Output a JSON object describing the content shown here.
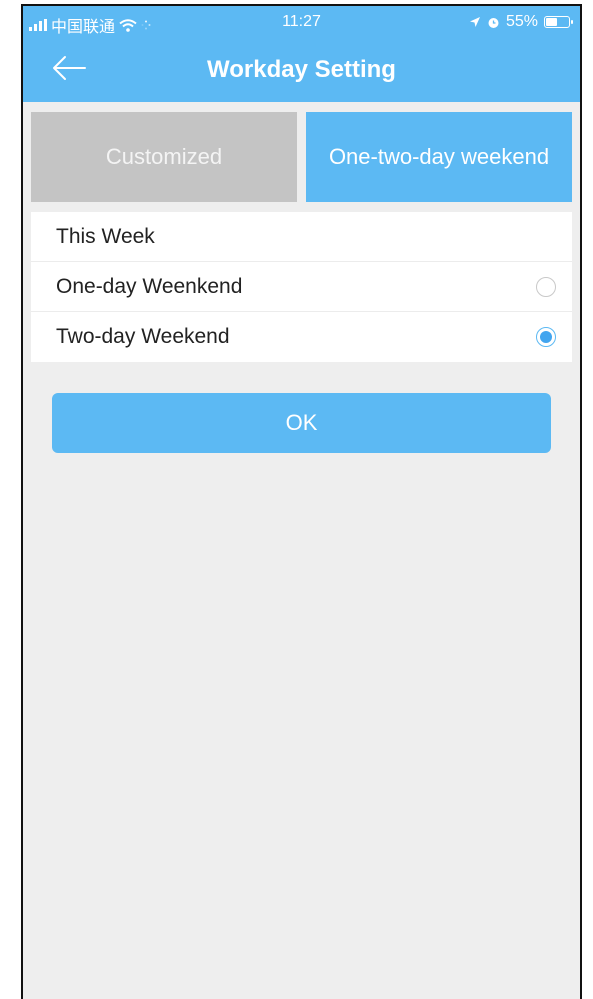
{
  "status_bar": {
    "carrier": "中国联通",
    "time": "11:27",
    "battery": "55%",
    "battery_level": 0.55
  },
  "nav": {
    "title": "Workday Setting",
    "back_icon": "back-arrow-icon"
  },
  "tabs": [
    {
      "label": "Customized",
      "active": false
    },
    {
      "label": "One-two-day weekend",
      "active": true
    }
  ],
  "list": {
    "header": "This Week",
    "options": [
      {
        "label": "One-day Weenkend",
        "selected": false
      },
      {
        "label": "Two-day Weekend",
        "selected": true
      }
    ]
  },
  "ok_button": {
    "label": "OK"
  },
  "colors": {
    "accent": "#5cb9f3",
    "inactive_tab": "#c4c4c4",
    "background": "#eeeeee"
  }
}
